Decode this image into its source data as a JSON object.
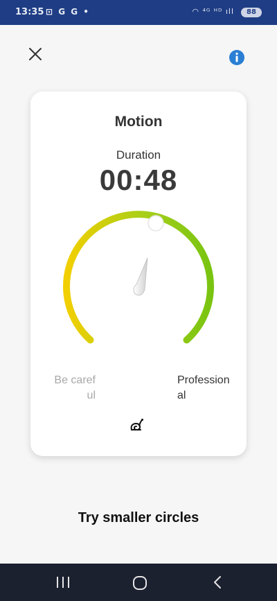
{
  "status_bar": {
    "time": "13:35",
    "left_icons": "⊡ G G •",
    "right_icons": "◠ ⁴ᴳ ᴴᴰ ıll",
    "battery": "88"
  },
  "header": {
    "close_icon": "close-icon",
    "info_icon": "info-icon",
    "accent_color": "#2a7fd4"
  },
  "card": {
    "title": "Motion",
    "duration_label": "Duration",
    "duration_value": "00:48",
    "gauge": {
      "level": 0.62,
      "colors": [
        "#f2cf00",
        "#a6cf1a",
        "#79c411"
      ]
    },
    "label_low": "Be careful",
    "label_high": "Professional",
    "footer_icon": "snail-icon"
  },
  "hint": "Try smaller circles",
  "nav": {
    "recent_icon": "recent-apps-icon",
    "home_icon": "home-icon",
    "back_icon": "back-icon"
  }
}
